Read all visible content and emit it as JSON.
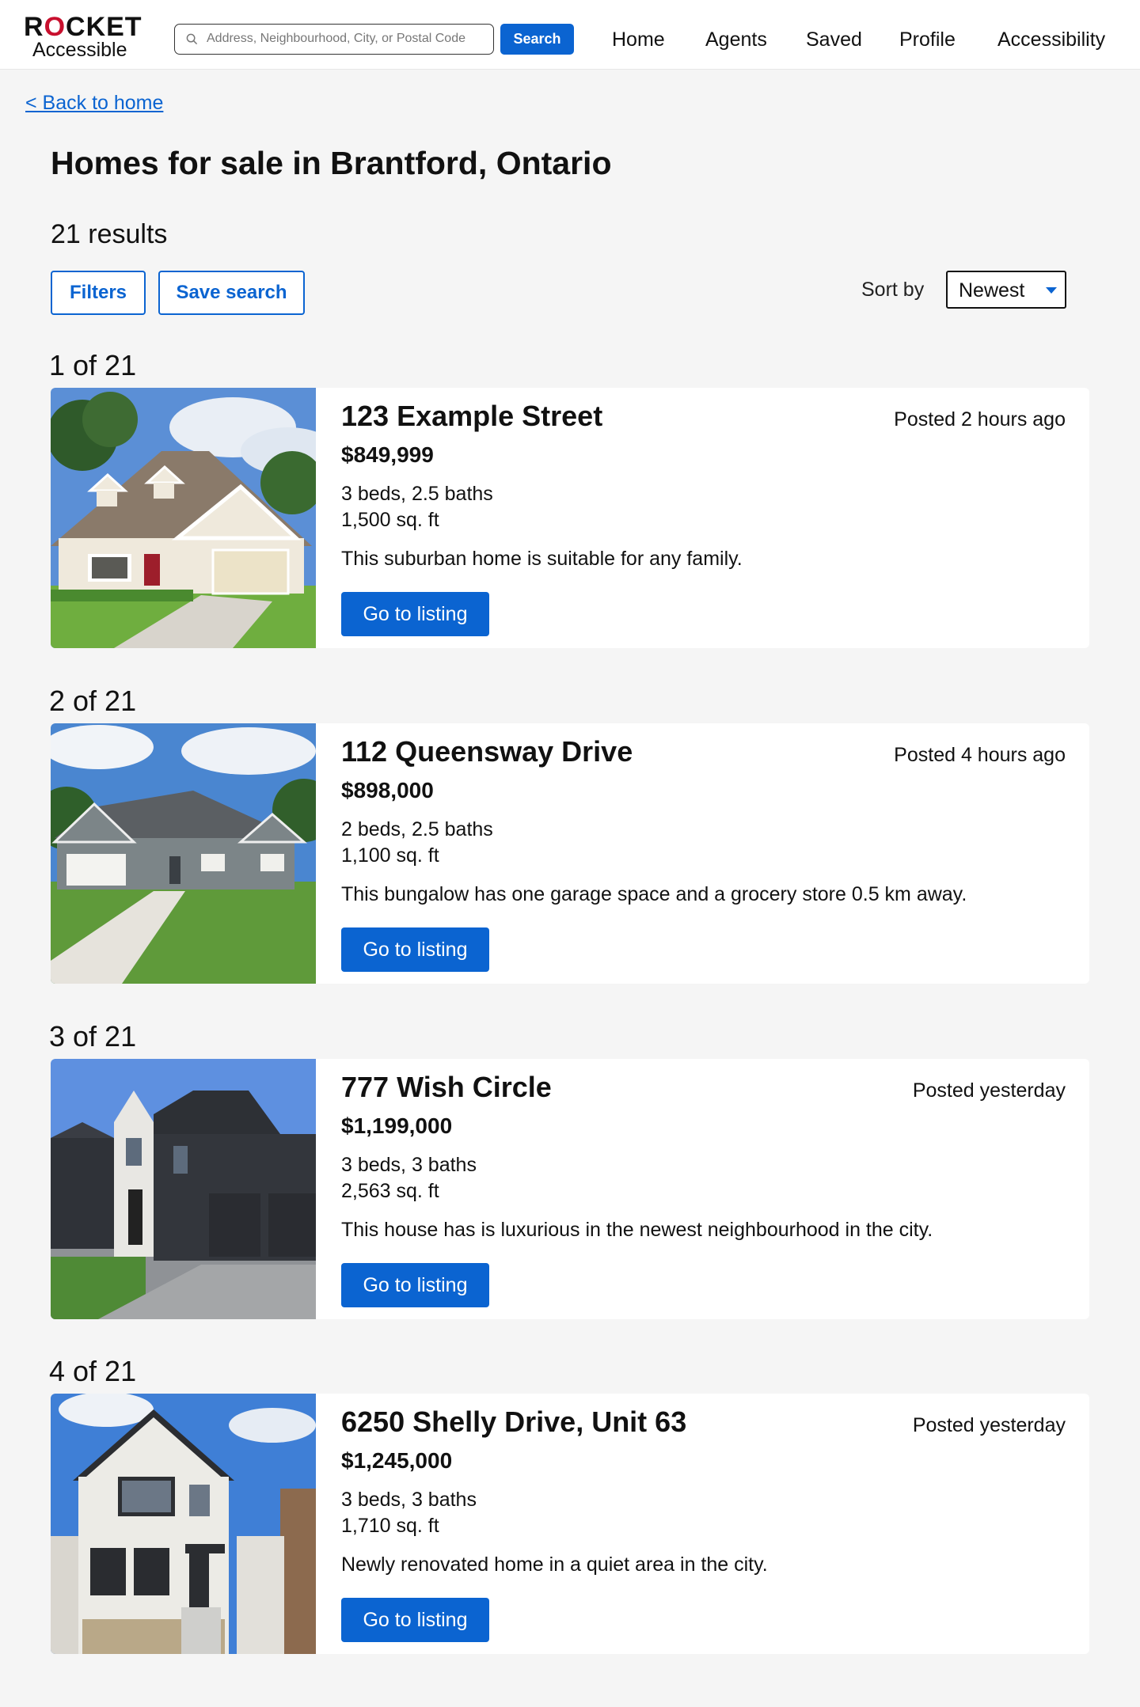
{
  "header": {
    "logo_main_before": "R",
    "logo_main_o": "O",
    "logo_main_after": "CKET",
    "logo_sub": "Accessible",
    "search_placeholder": "Address, Neighbourhood, City, or Postal Code",
    "search_button": "Search",
    "nav": [
      "Home",
      "Agents",
      "Saved",
      "Profile",
      "Accessibility"
    ]
  },
  "page": {
    "back_link": "< Back to home",
    "title": "Homes for sale in Brantford, Ontario",
    "results_count": "21 results",
    "filters_button": "Filters",
    "save_search_button": "Save search",
    "sort_label": "Sort by",
    "sort_value": "Newest"
  },
  "listings": [
    {
      "index": "1 of 21",
      "address": "123 Example Street",
      "posted": "Posted 2 hours ago",
      "price": "$849,999",
      "beds_baths": "3 beds, 2.5 baths",
      "sqft": "1,500 sq. ft",
      "description": "This suburban home is suitable for any family.",
      "cta": "Go to listing"
    },
    {
      "index": "2 of 21",
      "address": "112 Queensway Drive",
      "posted": "Posted 4 hours ago",
      "price": "$898,000",
      "beds_baths": "2 beds, 2.5 baths",
      "sqft": "1,100 sq. ft",
      "description": "This bungalow has one garage space and a grocery store 0.5 km away.",
      "cta": "Go to listing"
    },
    {
      "index": "3 of 21",
      "address": "777 Wish Circle",
      "posted": "Posted yesterday",
      "price": "$1,199,000",
      "beds_baths": "3 beds, 3 baths",
      "sqft": "2,563 sq. ft",
      "description": "This house has is luxurious in the newest neighbourhood in the city.",
      "cta": "Go to listing"
    },
    {
      "index": "4 of 21",
      "address": "6250 Shelly Drive, Unit 63",
      "posted": "Posted yesterday",
      "price": "$1,245,000",
      "beds_baths": "3 beds, 3 baths",
      "sqft": "1,710 sq. ft",
      "description": "Newly renovated home in a quiet area in the city.",
      "cta": "Go to listing"
    }
  ],
  "colors": {
    "accent": "#0b64d1",
    "logo_o": "#c8102e",
    "background": "#f5f5f5"
  }
}
